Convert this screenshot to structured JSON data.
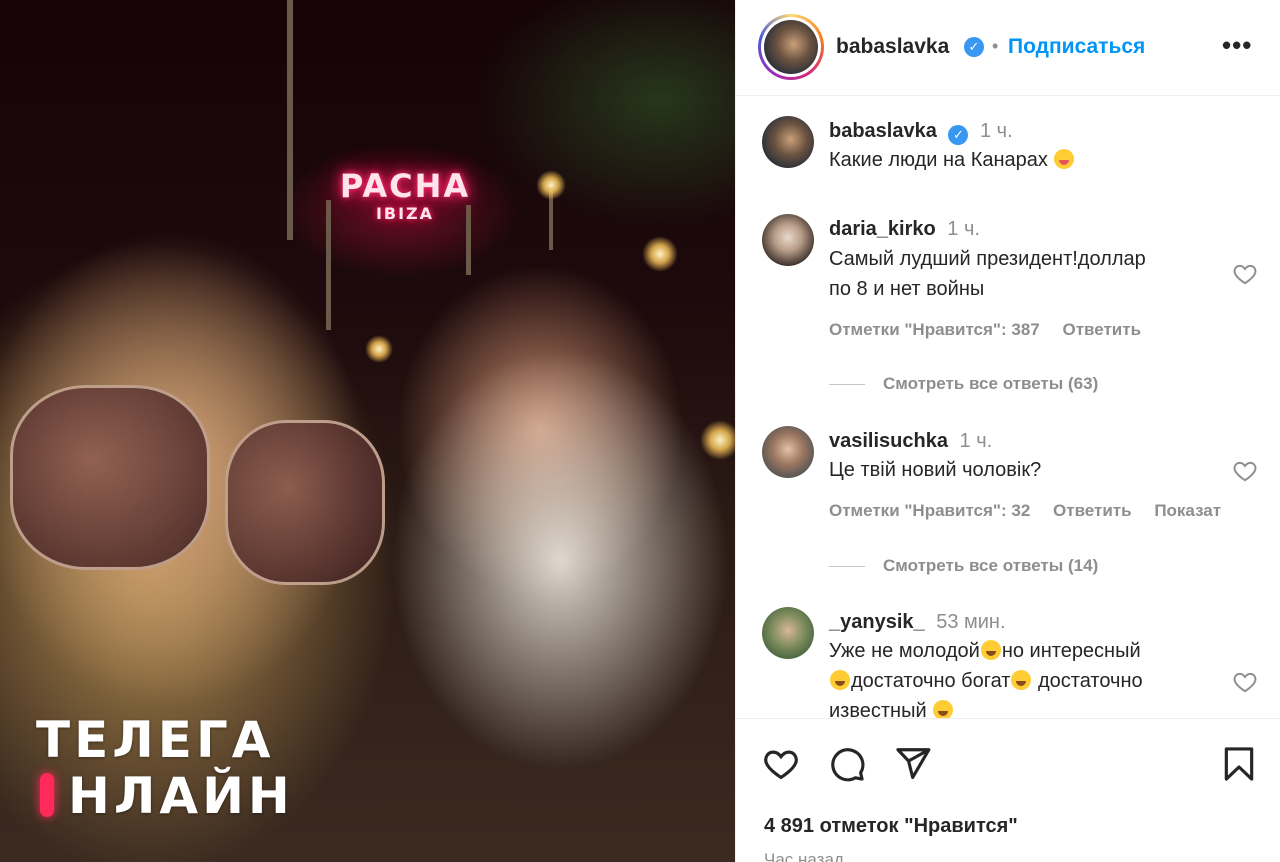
{
  "post": {
    "username": "babaslavka",
    "follow_label": "Подписаться",
    "likes_text": "4 891 отметок \"Нравится\"",
    "posted_time": "Час назад"
  },
  "photo": {
    "sign_title": "PACHA",
    "sign_subtitle": "IBIZA",
    "watermark_line1": "ТЕЛЕГА",
    "watermark_line2": "НЛАЙН"
  },
  "caption": {
    "username": "babaslavka",
    "time": "1 ч.",
    "text": "Какие люди на Канарах"
  },
  "comments": [
    {
      "username": "daria_kirko",
      "time": "1 ч.",
      "text_line1": "Самый лудший президент!доллар",
      "text_line2": "по 8 и нет войны",
      "likes": "Отметки \"Нравится\": 387",
      "reply": "Ответить",
      "view_replies": "Смотреть все ответы (63)"
    },
    {
      "username": "vasilisuchka",
      "time": "1 ч.",
      "text_line1": "Це твій новий чоловік?",
      "likes": "Отметки \"Нравится\": 32",
      "reply": "Ответить",
      "show": "Показат",
      "view_replies": "Смотреть все ответы (14)"
    },
    {
      "username": "_yanysik_",
      "time": "53 мин.",
      "text_line1a": "Уже не молодой",
      "text_line1b": "но интересный",
      "text_line2a": "достаточно богат",
      "text_line2b": " достаточно",
      "text_line3": "известный"
    }
  ],
  "icons": {
    "more": "more-icon",
    "heart": "heart-icon",
    "comment": "comment-icon",
    "share": "send-icon",
    "save": "bookmark-icon"
  },
  "colors": {
    "link_blue": "#0095f6",
    "verified_blue": "#3897f0",
    "secondary_text": "#8e8e8e"
  }
}
